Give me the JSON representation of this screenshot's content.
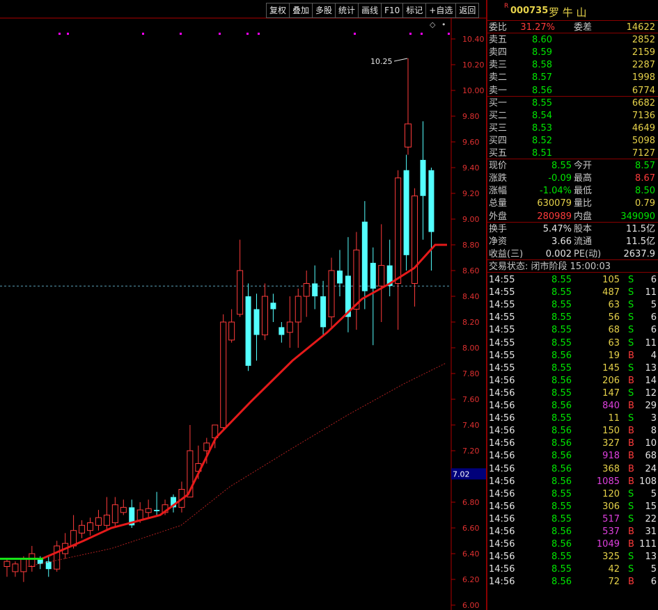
{
  "toolbar": [
    "复权",
    "叠加",
    "多股",
    "统计",
    "画线",
    "F10",
    "标记",
    "+自选",
    "返回"
  ],
  "chart": {
    "price_labels": [
      "10.40",
      "10.20",
      "10.00",
      "9.80",
      "9.60",
      "9.40",
      "9.20",
      "9.00",
      "8.80",
      "8.60",
      "8.40",
      "8.20",
      "8.00",
      "7.80",
      "7.60",
      "7.40",
      "7.20",
      "7.00",
      "6.80",
      "6.60",
      "6.40",
      "6.20",
      "6.00"
    ],
    "high_annotation": "10.25",
    "cursor_price": "7.02",
    "current_price_line": 8.48,
    "colors": {
      "up": "#ff3b3b",
      "down": "#54ffff",
      "ma_main": "#e51a1a",
      "ma_long": "#b02020",
      "ma_start": "#18e818",
      "axis": "#b00000",
      "marker": "#ff00ff"
    },
    "candles": [
      [
        6.3,
        6.34,
        6.22,
        6.36
      ],
      [
        6.26,
        6.32,
        6.22,
        6.34
      ],
      [
        6.26,
        6.36,
        6.18,
        6.38
      ],
      [
        6.3,
        6.4,
        6.26,
        6.46
      ],
      [
        6.36,
        6.32,
        6.28,
        6.38
      ],
      [
        6.34,
        6.28,
        6.22,
        6.38
      ],
      [
        6.28,
        6.46,
        6.26,
        6.5
      ],
      [
        6.4,
        6.48,
        6.36,
        6.56
      ],
      [
        6.46,
        6.58,
        6.44,
        6.7
      ],
      [
        6.56,
        6.62,
        6.52,
        6.66
      ],
      [
        6.58,
        6.64,
        6.54,
        6.68
      ],
      [
        6.62,
        6.68,
        6.58,
        6.74
      ],
      [
        6.62,
        6.7,
        6.58,
        6.84
      ],
      [
        6.64,
        6.78,
        6.6,
        6.84
      ],
      [
        6.72,
        6.76,
        6.7,
        6.82
      ],
      [
        6.76,
        6.62,
        6.6,
        6.82
      ],
      [
        6.66,
        6.74,
        6.64,
        6.8
      ],
      [
        6.72,
        6.75,
        6.68,
        6.82
      ],
      [
        6.74,
        6.73,
        6.7,
        6.88
      ],
      [
        6.72,
        6.78,
        6.7,
        6.82
      ],
      [
        6.84,
        6.76,
        6.72,
        6.86
      ],
      [
        6.76,
        6.9,
        6.72,
        6.96
      ],
      [
        6.84,
        7.2,
        6.84,
        7.4
      ],
      [
        7.04,
        7.1,
        6.98,
        7.24
      ],
      [
        7.2,
        7.26,
        7.1,
        7.3
      ],
      [
        7.3,
        7.4,
        7.22,
        7.4
      ],
      [
        7.38,
        8.2,
        7.36,
        8.26
      ],
      [
        8.06,
        8.2,
        8.04,
        8.3
      ],
      [
        8.26,
        8.6,
        8.24,
        8.84
      ],
      [
        8.4,
        7.86,
        7.82,
        8.5
      ],
      [
        8.3,
        8.1,
        7.9,
        8.42
      ],
      [
        8.1,
        8.4,
        8.06,
        8.5
      ],
      [
        8.35,
        8.3,
        8.2,
        8.42
      ],
      [
        8.16,
        8.1,
        8.04,
        8.2
      ],
      [
        8.12,
        8.2,
        8.0,
        8.4
      ],
      [
        8.2,
        8.4,
        8.0,
        8.46
      ],
      [
        8.4,
        8.5,
        8.24,
        8.6
      ],
      [
        8.5,
        8.4,
        8.3,
        8.64
      ],
      [
        8.4,
        8.16,
        8.1,
        8.52
      ],
      [
        8.24,
        8.6,
        8.16,
        8.7
      ],
      [
        8.6,
        8.5,
        8.4,
        8.76
      ],
      [
        8.56,
        8.24,
        8.12,
        8.86
      ],
      [
        8.3,
        8.76,
        8.14,
        8.9
      ],
      [
        8.98,
        8.44,
        8.3,
        9.14
      ],
      [
        8.66,
        8.46,
        8.02,
        8.78
      ],
      [
        8.48,
        8.64,
        8.2,
        8.96
      ],
      [
        8.64,
        8.48,
        8.4,
        8.84
      ],
      [
        8.5,
        9.32,
        8.14,
        9.38
      ],
      [
        9.38,
        8.72,
        8.6,
        9.5
      ],
      [
        8.5,
        9.18,
        8.32,
        9.24
      ],
      [
        9.46,
        9.18,
        8.84,
        9.76
      ],
      [
        9.38,
        8.9,
        8.6,
        9.4
      ]
    ],
    "tall_candle": [
      9.56,
      9.74,
      9.5,
      10.25
    ],
    "markers_count": 9
  },
  "quote": {
    "code": "000735",
    "name": "罗 牛 山",
    "weibi_label": "委比",
    "weibi": "31.27%",
    "weicha_label": "委差",
    "weicha": "14622",
    "sell": [
      {
        "label": "卖五",
        "price": "8.60",
        "vol": "2852"
      },
      {
        "label": "卖四",
        "price": "8.59",
        "vol": "2159"
      },
      {
        "label": "卖三",
        "price": "8.58",
        "vol": "2287"
      },
      {
        "label": "卖二",
        "price": "8.57",
        "vol": "1998"
      },
      {
        "label": "卖一",
        "price": "8.56",
        "vol": "6774"
      }
    ],
    "buy": [
      {
        "label": "买一",
        "price": "8.55",
        "vol": "6682"
      },
      {
        "label": "买二",
        "price": "8.54",
        "vol": "7136"
      },
      {
        "label": "买三",
        "price": "8.53",
        "vol": "4649"
      },
      {
        "label": "买四",
        "price": "8.52",
        "vol": "5098"
      },
      {
        "label": "买五",
        "price": "8.51",
        "vol": "7127"
      }
    ],
    "stats": [
      {
        "l1": "现价",
        "v1": "8.55",
        "c1": "g",
        "l2": "今开",
        "v2": "8.57",
        "c2": "g"
      },
      {
        "l1": "涨跌",
        "v1": "-0.09",
        "c1": "g",
        "l2": "最高",
        "v2": "8.67",
        "c2": "rd"
      },
      {
        "l1": "涨幅",
        "v1": "-1.04%",
        "c1": "g",
        "l2": "最低",
        "v2": "8.50",
        "c2": "g"
      },
      {
        "l1": "总量",
        "v1": "630079",
        "c1": "y",
        "l2": "量比",
        "v2": "0.79",
        "c2": "y"
      },
      {
        "l1": "外盘",
        "v1": "280989",
        "c1": "rd",
        "l2": "内盘",
        "v2": "349090",
        "c2": "g"
      }
    ],
    "fund": [
      {
        "l1": "换手",
        "v1": "5.47%",
        "l2": "股本",
        "v2": "11.5亿"
      },
      {
        "l1": "净资",
        "v1": "3.66",
        "l2": "流通",
        "v2": "11.5亿"
      },
      {
        "l1": "收益(三)",
        "v1": "0.002",
        "l2": "PE(动)",
        "v2": "2637.9"
      }
    ],
    "trade_status": "交易状态: 闭市阶段 15:00:03"
  },
  "ticks": [
    {
      "t": "14:55",
      "p": "8.55",
      "v": "105",
      "bs": "S",
      "n": "6"
    },
    {
      "t": "14:55",
      "p": "8.55",
      "v": "487",
      "bs": "S",
      "n": "11"
    },
    {
      "t": "14:55",
      "p": "8.55",
      "v": "63",
      "bs": "S",
      "n": "5"
    },
    {
      "t": "14:55",
      "p": "8.55",
      "v": "56",
      "bs": "S",
      "n": "6"
    },
    {
      "t": "14:55",
      "p": "8.55",
      "v": "68",
      "bs": "S",
      "n": "6"
    },
    {
      "t": "14:55",
      "p": "8.55",
      "v": "63",
      "bs": "S",
      "n": "11"
    },
    {
      "t": "14:55",
      "p": "8.56",
      "v": "19",
      "bs": "B",
      "n": "4"
    },
    {
      "t": "14:55",
      "p": "8.55",
      "v": "145",
      "bs": "S",
      "n": "13"
    },
    {
      "t": "14:56",
      "p": "8.56",
      "v": "206",
      "bs": "B",
      "n": "14"
    },
    {
      "t": "14:56",
      "p": "8.55",
      "v": "147",
      "bs": "S",
      "n": "12"
    },
    {
      "t": "14:56",
      "p": "8.56",
      "v": "840",
      "bs": "B",
      "n": "29"
    },
    {
      "t": "14:56",
      "p": "8.55",
      "v": "11",
      "bs": "S",
      "n": "3"
    },
    {
      "t": "14:56",
      "p": "8.56",
      "v": "150",
      "bs": "B",
      "n": "8"
    },
    {
      "t": "14:56",
      "p": "8.56",
      "v": "327",
      "bs": "B",
      "n": "10"
    },
    {
      "t": "14:56",
      "p": "8.56",
      "v": "918",
      "bs": "B",
      "n": "68"
    },
    {
      "t": "14:56",
      "p": "8.56",
      "v": "368",
      "bs": "B",
      "n": "24"
    },
    {
      "t": "14:56",
      "p": "8.56",
      "v": "1085",
      "bs": "B",
      "n": "108"
    },
    {
      "t": "14:56",
      "p": "8.55",
      "v": "120",
      "bs": "S",
      "n": "5"
    },
    {
      "t": "14:56",
      "p": "8.55",
      "v": "306",
      "bs": "S",
      "n": "15"
    },
    {
      "t": "14:56",
      "p": "8.55",
      "v": "517",
      "bs": "S",
      "n": "22"
    },
    {
      "t": "14:56",
      "p": "8.56",
      "v": "537",
      "bs": "B",
      "n": "31"
    },
    {
      "t": "14:56",
      "p": "8.56",
      "v": "1049",
      "bs": "B",
      "n": "111"
    },
    {
      "t": "14:56",
      "p": "8.55",
      "v": "325",
      "bs": "S",
      "n": "13"
    },
    {
      "t": "14:56",
      "p": "8.55",
      "v": "42",
      "bs": "S",
      "n": "5"
    },
    {
      "t": "14:56",
      "p": "8.56",
      "v": "72",
      "bs": "B",
      "n": "6"
    }
  ]
}
